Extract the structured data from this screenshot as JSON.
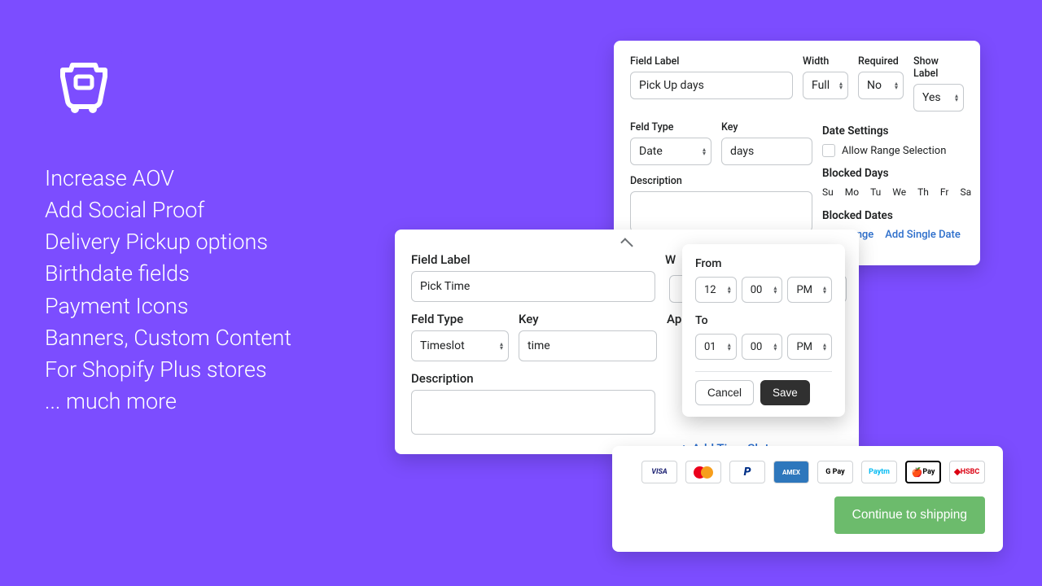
{
  "features": [
    "Increase AOV",
    "Add Social Proof",
    "Delivery Pickup options",
    "Birthdate fields",
    "Payment Icons",
    "Banners, Custom Content",
    "For Shopify Plus stores",
    "... much more"
  ],
  "cardTop": {
    "fieldLabel_label": "Field Label",
    "fieldLabel_value": "Pick Up days",
    "width_label": "Width",
    "width_value": "Full",
    "required_label": "Required",
    "required_value": "No",
    "showLabel_label": "Show Label",
    "showLabel_value": "Yes",
    "fieldType_label": "Feld Type",
    "fieldType_value": "Date",
    "key_label": "Key",
    "key_value": "days",
    "description_label": "Description",
    "dateSettings_title": "Date Settings",
    "allowRange_label": "Allow Range Selection",
    "blockedDays_title": "Blocked Days",
    "days": [
      "Su",
      "Mo",
      "Tu",
      "We",
      "Th",
      "Fr",
      "Sa"
    ],
    "blockedDates_title": "Blocked Dates",
    "addRange_label": "Add Range",
    "addSingle_label": "Add Single Date"
  },
  "cardMid": {
    "fieldLabel_label": "Field Label",
    "fieldLabel_value": "Pick Time",
    "width_letter": "W",
    "fieldType_label": "Feld Type",
    "fieldType_value": "Timeslot",
    "key_label": "Key",
    "key_value": "time",
    "ap_letters": "Ap",
    "description_label": "Description",
    "addTimeSlot_label": "Add Time Slot"
  },
  "popover": {
    "from_label": "From",
    "from_hour": "12",
    "from_min": "00",
    "from_ampm": "PM",
    "to_label": "To",
    "to_hour": "01",
    "to_min": "00",
    "to_ampm": "PM",
    "cancel": "Cancel",
    "save": "Save"
  },
  "payments": {
    "visa": "VISA",
    "pp": "PayPal",
    "amex": "AMEX",
    "gpay": "G Pay",
    "paytm": "Paytm",
    "applepay": "Pay",
    "hsbc": "HSBC"
  },
  "continue_label": "Continue to shipping"
}
